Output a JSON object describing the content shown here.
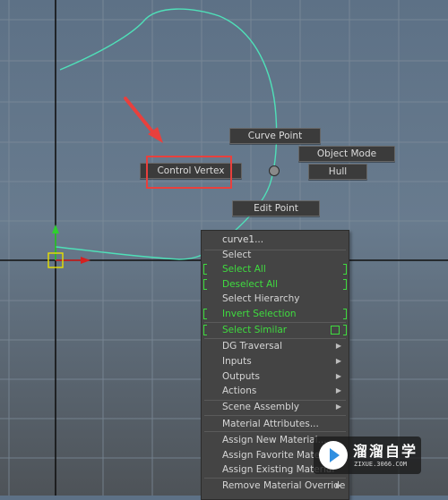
{
  "colors": {
    "curve": "#4fe0b8",
    "grid": "#7f8d9b",
    "axis": "#111111",
    "menu_bg": "#444444",
    "menu_green": "#3fdc3f",
    "annotation_red": "#e8403d"
  },
  "marking_menu": {
    "curve_point": "Curve Point",
    "object_mode": "Object Mode",
    "control_vertex": "Control Vertex",
    "hull": "Hull",
    "edit_point": "Edit Point"
  },
  "context_menu": {
    "header": "curve1...",
    "items": [
      {
        "label": "Select"
      },
      {
        "label": "Select All"
      },
      {
        "label": "Deselect All"
      },
      {
        "label": "Select Hierarchy"
      },
      {
        "label": "Invert Selection"
      },
      {
        "label": "Select Similar"
      },
      {
        "label": "DG Traversal"
      },
      {
        "label": "Inputs"
      },
      {
        "label": "Outputs"
      },
      {
        "label": "Actions"
      },
      {
        "label": "Scene Assembly"
      },
      {
        "label": "Material Attributes..."
      },
      {
        "label": "Assign New Material..."
      },
      {
        "label": "Assign Favorite Material"
      },
      {
        "label": "Assign Existing Material"
      },
      {
        "label": "Remove Material Override"
      }
    ],
    "submenu_icon": "chevron-right-icon"
  },
  "watermark": {
    "title": "溜溜自学",
    "subtitle": "ZIXUE.3066.COM"
  }
}
